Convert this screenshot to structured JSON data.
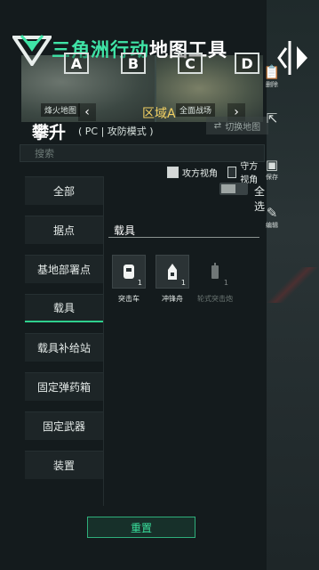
{
  "app": {
    "logo_green": "三角洲行动",
    "logo_white": "地图工具"
  },
  "banner": {
    "tags": [
      "A",
      "B",
      "C",
      "D"
    ],
    "caption_left": "烽火地图",
    "caption_right": "全面战场",
    "zone_label": "区域A",
    "switch_map_label": "切换地图"
  },
  "map": {
    "title": "攀升",
    "subtitle": "( PC | 攻防模式 )"
  },
  "search": {
    "placeholder": "搜索"
  },
  "view": {
    "attack_label": "攻方视角",
    "defense_label": "守方视角",
    "attack_checked": true,
    "defense_checked": false,
    "select_all_label": "全选"
  },
  "categories": [
    {
      "label": "全部"
    },
    {
      "label": "据点"
    },
    {
      "label": "基地部署点"
    },
    {
      "label": "载具"
    },
    {
      "label": "载具补给站"
    },
    {
      "label": "固定弹药箱"
    },
    {
      "label": "固定武器"
    },
    {
      "label": "装置"
    }
  ],
  "active_category": "载具",
  "section": {
    "title": "载具",
    "items": [
      {
        "label": "突击车",
        "count": "1",
        "icon": "assault-vehicle-icon"
      },
      {
        "label": "冲锋舟",
        "count": "1",
        "icon": "assault-boat-icon"
      },
      {
        "label": "轮式突击炮",
        "count": "1",
        "icon": "wheeled-assault-gun-icon"
      }
    ]
  },
  "rail": {
    "items": [
      {
        "label": "删除",
        "icon": "clipboard-icon"
      },
      {
        "label": "",
        "icon": "share-icon"
      },
      {
        "label": "保存",
        "icon": "save-icon"
      },
      {
        "label": "编辑",
        "icon": "edit-icon"
      }
    ]
  },
  "reset_label": "重置",
  "colors": {
    "accent": "#2fd08e",
    "zone": "#f3d163",
    "background": "#141b1d"
  }
}
